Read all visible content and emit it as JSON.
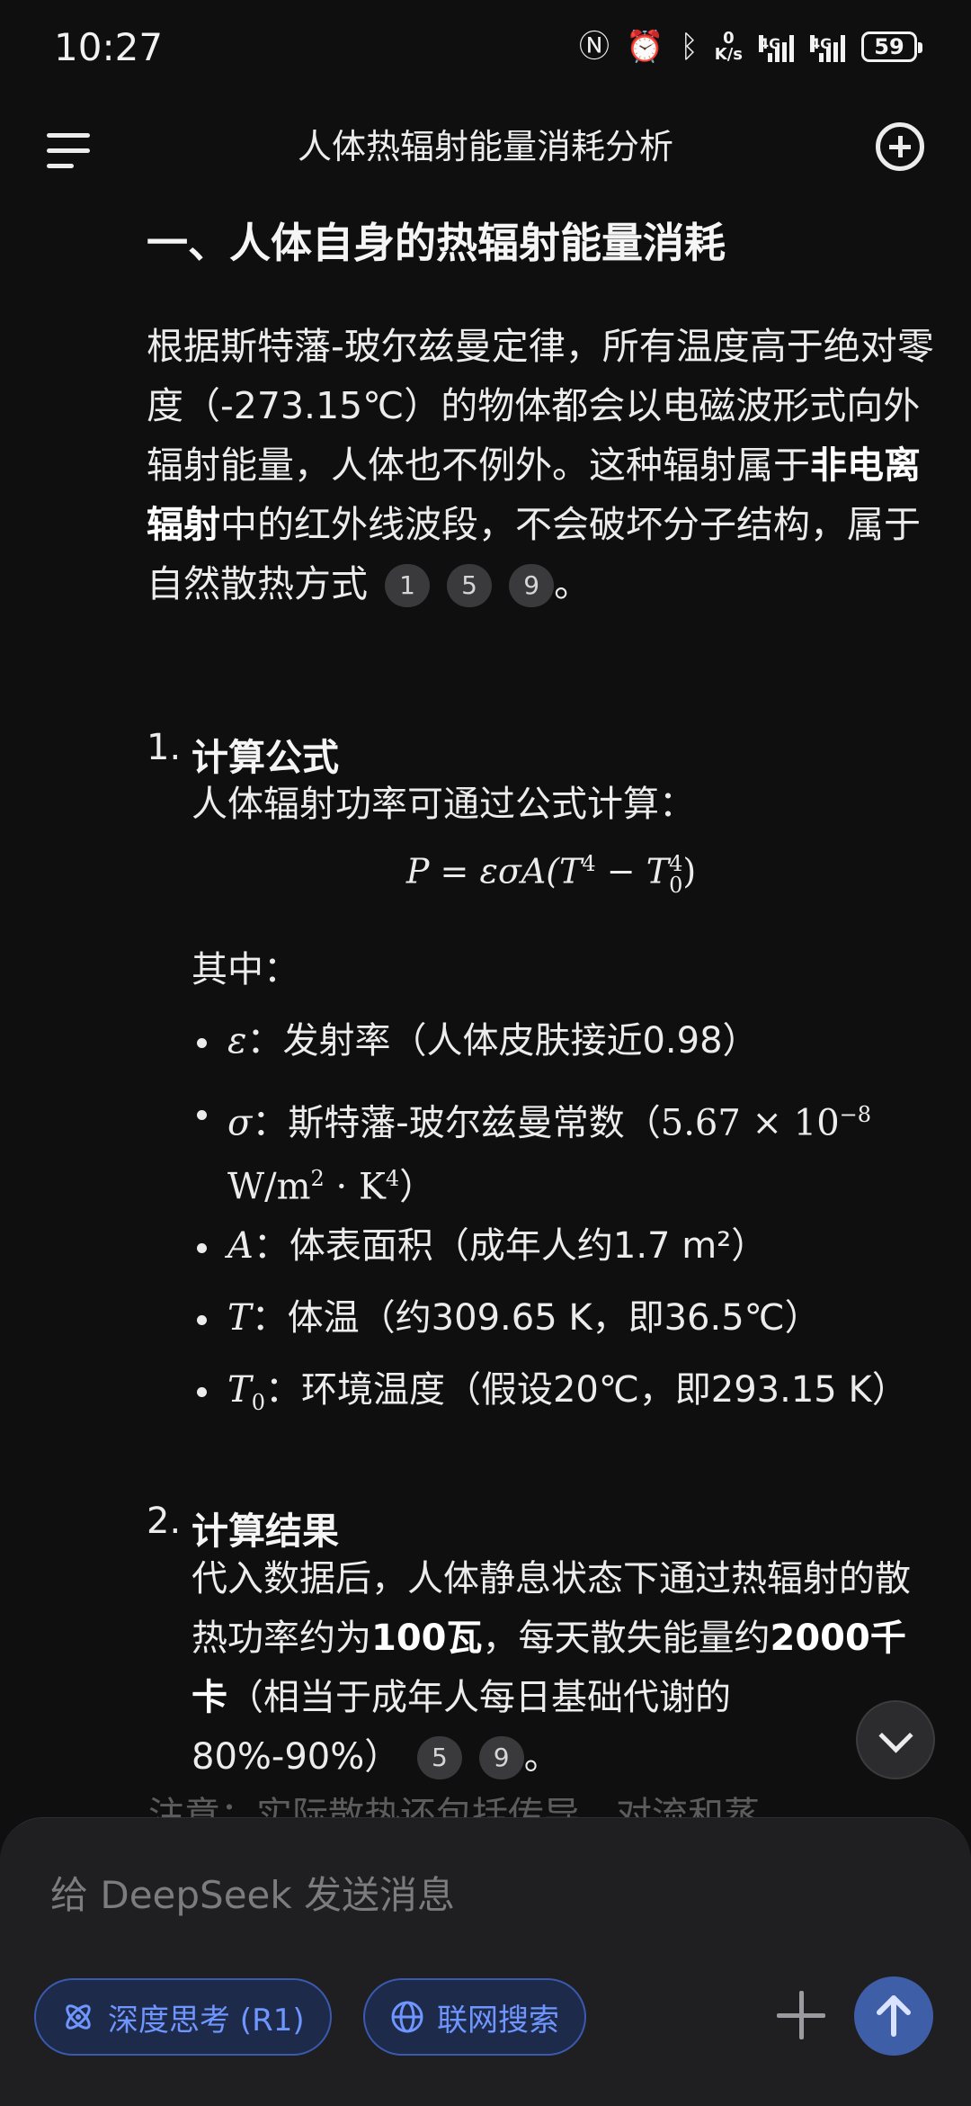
{
  "status_bar": {
    "time": "10:27",
    "net_speed_value": "0",
    "net_speed_unit": "K/s",
    "network1": "4G",
    "network2": "4G",
    "battery": "59"
  },
  "app_bar": {
    "title": "人体热辐射能量消耗分析",
    "menu_icon": "hamburger-icon",
    "new_chat_icon": "new-chat-icon"
  },
  "article": {
    "heading": "一、人体自身的热辐射能量消耗",
    "intro": {
      "part1": "根据斯特藩-玻尔兹曼定律，所有温度高于绝对零度（-273.15℃）的物体都会以电磁波形式向外辐射能量，人体也不例外。这种辐射属于",
      "bold": "非电离辐射",
      "part2": "中的红外线波段，不会破坏分子结构，属于自然散热方式",
      "citations": [
        "1",
        "5",
        "9"
      ],
      "end": "。"
    },
    "section1": {
      "number": "1.",
      "title": "计算公式",
      "text": "人体辐射功率可通过公式计算：",
      "formula": {
        "lhs": "P",
        "eq": "=",
        "rhs1": "εσA(T",
        "exp1": "4",
        "minus": "−",
        "rhs2": "T",
        "exp2": "4",
        "sub2": "0",
        "close": ")"
      },
      "where": "其中：",
      "vars": [
        {
          "symbol": "ε",
          "text": "：发射率（人体皮肤接近0.98）"
        },
        {
          "symbol": "σ",
          "text": "：斯特藩-玻尔兹曼常数（",
          "math1": "5.67 × 10",
          "exp": "−8",
          "math2": "W/m",
          "exp2": "2",
          "math3": " · K",
          "exp3": "4",
          "close": "）"
        },
        {
          "symbol": "A",
          "text": "：体表面积（成年人约1.7 m²）"
        },
        {
          "symbol": "T",
          "text": "：体温（约309.65 K，即36.5℃）"
        },
        {
          "symbol": "T",
          "sub": "0",
          "text": "：环境温度（假设20℃，即293.15 K）"
        }
      ]
    },
    "section2": {
      "number": "2.",
      "title": "计算结果",
      "part1": "代入数据后，人体静息状态下通过热辐射的散热功率约为",
      "bold1": "100瓦",
      "part2": "，每天散失能量约",
      "bold2": "2000千卡",
      "part3": "（相当于成年人每日基础代谢的80%-90%）",
      "citations": [
        "5",
        "9"
      ],
      "end": "。",
      "cutoff_text": "注意：实际散热还包括传导、对流和蒸"
    }
  },
  "composer": {
    "placeholder": "给 DeepSeek 发送消息",
    "chip_deepthink": "深度思考 (R1)",
    "chip_search": "联网搜索",
    "chip_deepthink_icon": "atom-icon",
    "chip_search_icon": "globe-icon",
    "attach_icon": "plus-icon",
    "send_icon": "arrow-up-icon"
  },
  "colors": {
    "background": "#0f0f10",
    "text": "#ececec",
    "accent": "#6f95ff",
    "send_button": "#3f5ea8"
  }
}
